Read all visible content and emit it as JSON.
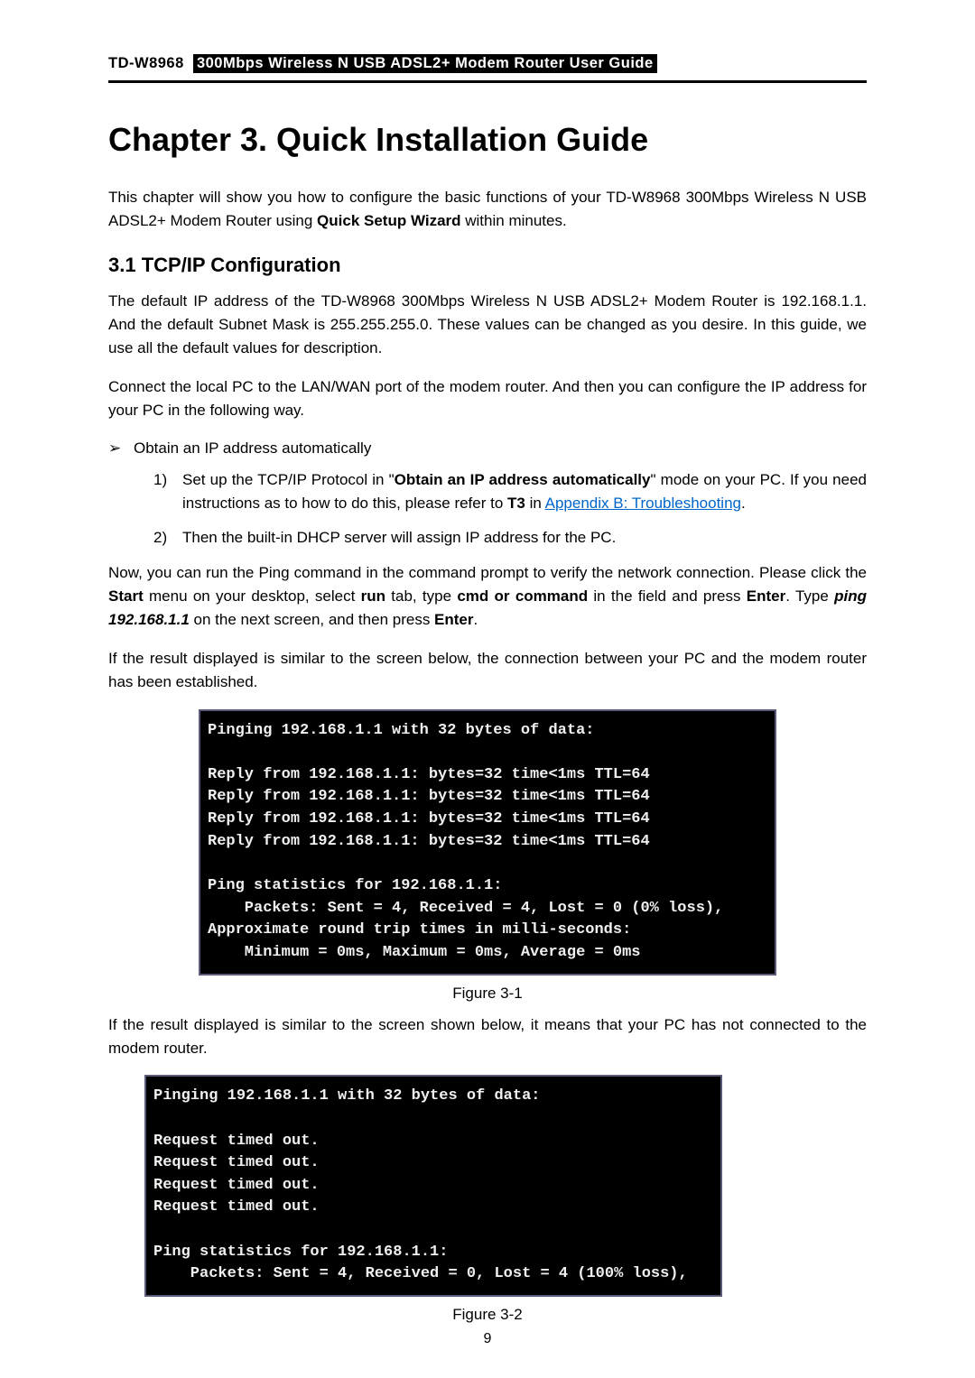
{
  "header": {
    "model": "TD-W8968",
    "title": "300Mbps Wireless N USB ADSL2+ Modem Router User Guide"
  },
  "chapter_title": "Chapter 3. Quick Installation Guide",
  "intro_prefix": "This chapter will show you how to configure the basic functions of your TD-W8968 300Mbps Wireless N USB ADSL2+ Modem Router using ",
  "intro_bold": "Quick Setup Wizard",
  "intro_suffix": " within minutes.",
  "section_title": "3.1  TCP/IP Configuration",
  "para1": "The default IP address of the TD-W8968 300Mbps Wireless N USB ADSL2+ Modem Router is 192.168.1.1. And the default Subnet Mask is 255.255.255.0. These values can be changed as you desire. In this guide, we use all the default values for description.",
  "para2": "Connect the local PC to the LAN/WAN port of the modem router. And then you can configure the IP address for your PC in the following way.",
  "bullet1": "Obtain an IP address automatically",
  "list1_prefix": "Set up the TCP/IP Protocol in \"",
  "list1_bold": "Obtain an IP address automatically",
  "list1_mid": "\" mode on your PC. If you need instructions as to how to do this, please refer to ",
  "list1_bold2": "T3",
  "list1_mid2": " in ",
  "list1_link": "Appendix B: Troubleshooting",
  "list1_suffix": ".",
  "list2": "Then the built-in DHCP server will assign IP address for the PC.",
  "para3_prefix": "Now, you can run the Ping command in the command prompt to verify the network connection. Please click the ",
  "para3_b1": "Start",
  "para3_m1": " menu on your desktop, select ",
  "para3_b2": "run",
  "para3_m2": " tab, type ",
  "para3_b3": "cmd or command",
  "para3_m3": " in the field and press ",
  "para3_b4": "Enter",
  "para3_m4": ". Type ",
  "para3_i": "ping 192.168.1.1",
  "para3_m5": " on the next screen, and then press ",
  "para3_b5": "Enter",
  "para3_suffix": ".",
  "para4": "If the result displayed is similar to the screen below, the connection between your PC and the modem router has been established.",
  "term1": "Pinging 192.168.1.1 with 32 bytes of data:\n\nReply from 192.168.1.1: bytes=32 time<1ms TTL=64\nReply from 192.168.1.1: bytes=32 time<1ms TTL=64\nReply from 192.168.1.1: bytes=32 time<1ms TTL=64\nReply from 192.168.1.1: bytes=32 time<1ms TTL=64\n\nPing statistics for 192.168.1.1:\n    Packets: Sent = 4, Received = 4, Lost = 0 (0% loss),\nApproximate round trip times in milli-seconds:\n    Minimum = 0ms, Maximum = 0ms, Average = 0ms",
  "fig1": "Figure 3-1",
  "para5": "If the result displayed is similar to the screen shown below, it means that your PC has not connected to the modem router.",
  "term2": "Pinging 192.168.1.1 with 32 bytes of data:\n\nRequest timed out.\nRequest timed out.\nRequest timed out.\nRequest timed out.\n\nPing statistics for 192.168.1.1:\n    Packets: Sent = 4, Received = 0, Lost = 4 (100% loss),",
  "fig2": "Figure 3-2",
  "page_num": "9"
}
